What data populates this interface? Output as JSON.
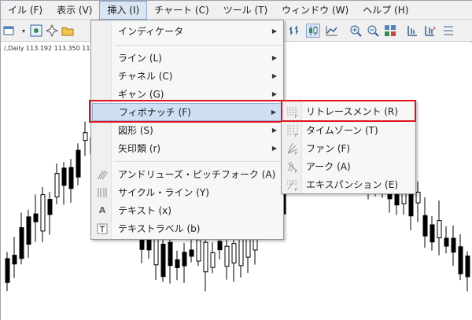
{
  "menubar": {
    "items": [
      "イル (F)",
      "表示 (V)",
      "挿入 (I)",
      "チャート (C)",
      "ツール (T)",
      "ウィンドウ (W)",
      "ヘルプ (H)"
    ],
    "active_index": 2
  },
  "chart": {
    "info": "/,Daily  113.192 113.350 113"
  },
  "insert_menu": {
    "items": [
      {
        "label": "インディケータ",
        "icon": "",
        "submenu": true
      },
      {
        "label": "ライン (L)",
        "icon": "",
        "submenu": true
      },
      {
        "label": "チャネル (C)",
        "icon": "",
        "submenu": true
      },
      {
        "label": "ギャン (G)",
        "icon": "",
        "submenu": true
      },
      {
        "label": "フィボナッチ (F)",
        "icon": "",
        "submenu": true
      },
      {
        "label": "図形 (S)",
        "icon": "",
        "submenu": true
      },
      {
        "label": "矢印類 (r)",
        "icon": "",
        "submenu": true
      },
      {
        "label": "アンドリューズ・ピッチフォーク (A)",
        "icon": "pitchfork-icon",
        "submenu": false
      },
      {
        "label": "サイクル・ライン (Y)",
        "icon": "cycle-lines-icon",
        "submenu": false
      },
      {
        "label": "テキスト (x)",
        "icon": "text-icon",
        "submenu": false
      },
      {
        "label": "テキストラベル (b)",
        "icon": "text-label-icon",
        "submenu": false
      }
    ],
    "highlighted_index": 4
  },
  "fibonacci_submenu": {
    "items": [
      {
        "label": "リトレースメント (R)",
        "icon": "fibo-retracement-icon"
      },
      {
        "label": "タイムゾーン (T)",
        "icon": "fibo-timezones-icon"
      },
      {
        "label": "ファン (F)",
        "icon": "fibo-fan-icon"
      },
      {
        "label": "アーク (A)",
        "icon": "fibo-arcs-icon"
      },
      {
        "label": "エキスパンション (E)",
        "icon": "fibo-expansion-icon"
      }
    ]
  },
  "colors": {
    "highlight": "#cfe0f4",
    "annotation_box": "#e0141e",
    "candle": "#000000"
  }
}
